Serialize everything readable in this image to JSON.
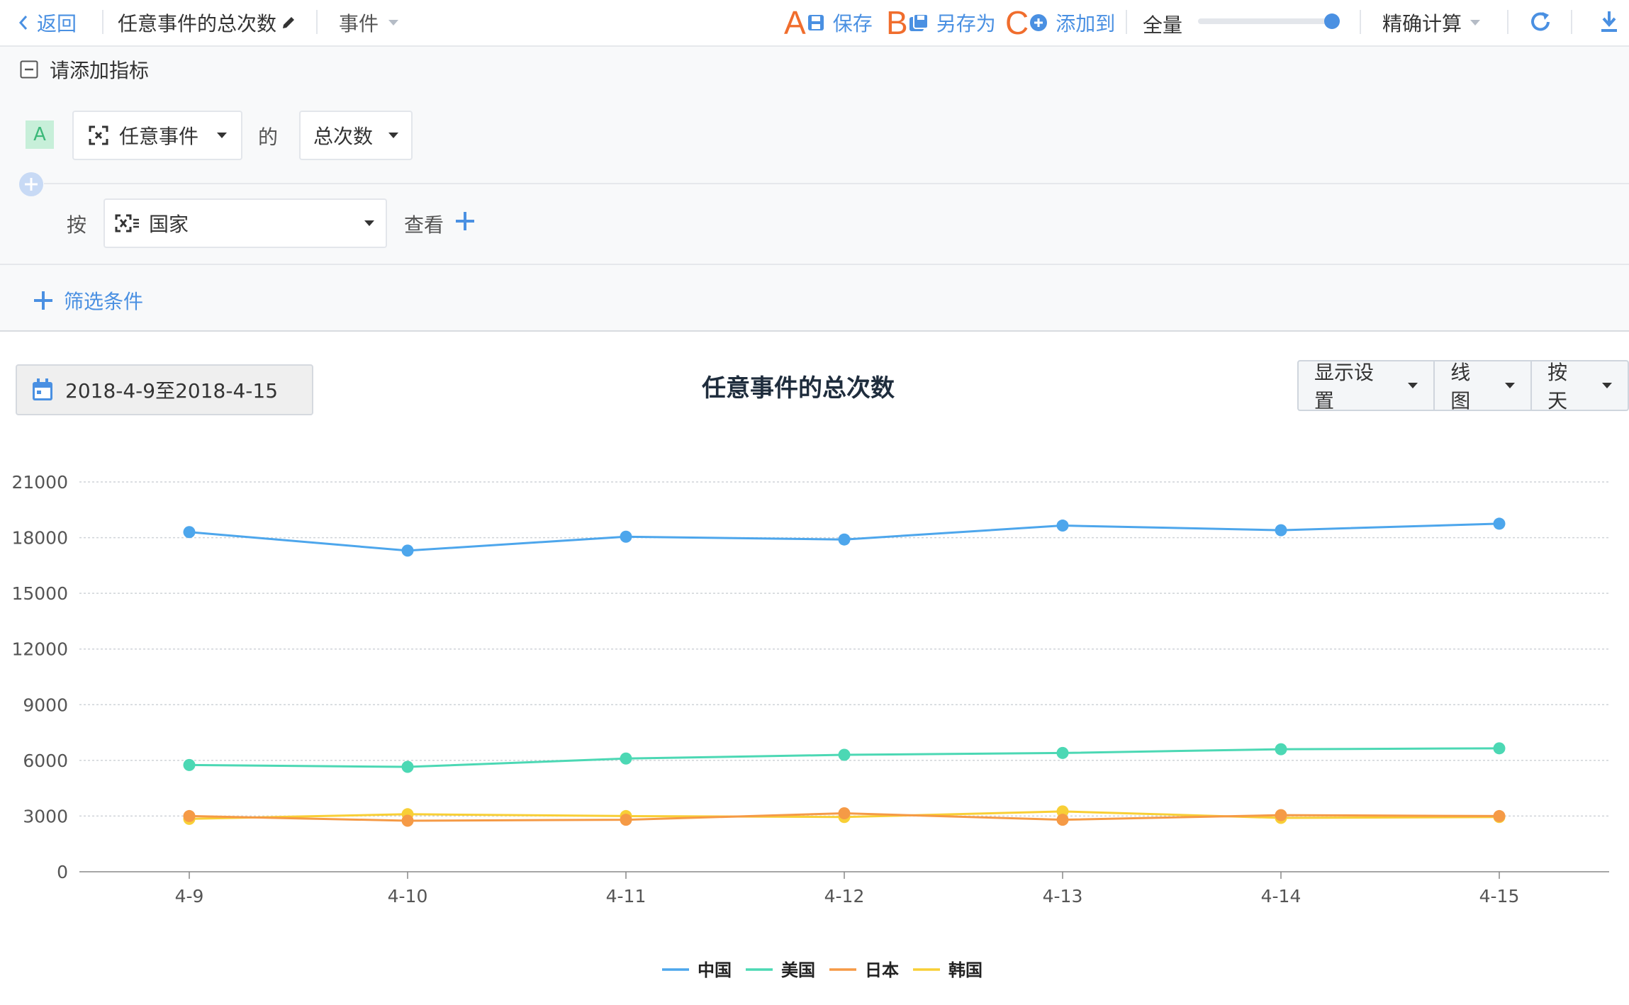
{
  "header": {
    "back_label": "返回",
    "report_title": "任意事件的总次数",
    "type_label": "事件",
    "save_letter": "A",
    "save_label": "保存",
    "saveas_letter": "B",
    "saveas_label": "另存为",
    "addto_letter": "C",
    "addto_label": "添加到",
    "sampling_label": "全量",
    "sampling_value_percent": 100,
    "calc_label": "精确计算"
  },
  "metrics": {
    "header_label": "请添加指标",
    "metric_badge": "A",
    "event_label": "任意事件",
    "of_label": "的",
    "measure_label": "总次数"
  },
  "groupby": {
    "by_label": "按",
    "property_label": "国家",
    "view_label": "查看"
  },
  "filter": {
    "add_filter_label": "筛选条件"
  },
  "chart_header": {
    "date_range": "2018-4-9至2018-4-15",
    "title": "任意事件的总次数",
    "display_settings": "显示设置",
    "chart_type": "线图",
    "granularity": "按天"
  },
  "colors": {
    "accent": "#4a90e2",
    "orange_letter": "#f06d2d",
    "series": [
      "#4da6ec",
      "#4cd8b4",
      "#f59a46",
      "#f8cf36"
    ]
  },
  "chart_data": {
    "type": "line",
    "title": "任意事件的总次数",
    "categories": [
      "4-9",
      "4-10",
      "4-11",
      "4-12",
      "4-13",
      "4-14",
      "4-15"
    ],
    "yticks": [
      "0",
      "3000",
      "6000",
      "9000",
      "12000",
      "15000",
      "18000",
      "21000"
    ],
    "ylim": [
      0,
      21000
    ],
    "grid": true,
    "legend_position": "bottom-center",
    "series": [
      {
        "name": "中国",
        "color": "#4da6ec",
        "values": [
          18300,
          17300,
          18050,
          17900,
          18650,
          18400,
          18750
        ]
      },
      {
        "name": "美国",
        "color": "#4cd8b4",
        "values": [
          5750,
          5650,
          6100,
          6300,
          6400,
          6600,
          6650
        ]
      },
      {
        "name": "日本",
        "color": "#f59a46",
        "values": [
          3000,
          2750,
          2800,
          3150,
          2800,
          3050,
          3000
        ]
      },
      {
        "name": "韩国",
        "color": "#f8cf36",
        "values": [
          2850,
          3100,
          3000,
          2950,
          3250,
          2900,
          2950
        ]
      }
    ]
  }
}
